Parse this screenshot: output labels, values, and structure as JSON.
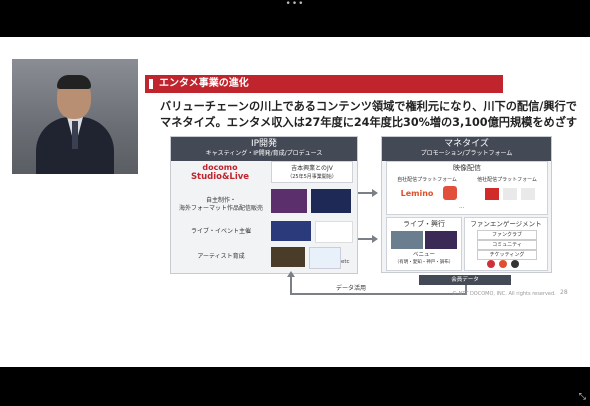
{
  "top_bar": {
    "dots": "•••"
  },
  "slide": {
    "section_title": "エンタメ事業の進化",
    "headline_line1": "バリューチェーンの川上であるコンテンツ領域で権利元になり、川下の配信/興行で",
    "headline_line2": "マネタイズ。エンタメ収入は27年度に24年度比30%増の3,100億円規模をめざす",
    "ip_panel": {
      "title": "IP開発",
      "subtitle": "キャスティング・IP開発/育成/プロデュース",
      "logo_line1": "docomo",
      "logo_line2": "Studio&Live",
      "jv_title": "吉本興業とのJV",
      "jv_note": "（25年5月事業開始）",
      "row1_label_line1": "自主制作・",
      "row1_label_line2": "海外フォーマット作品配信販売",
      "row2_label": "ライブ・イベント主催",
      "row3_label": "アーティスト育成",
      "etc": "etc"
    },
    "monetize_panel": {
      "title": "マネタイズ",
      "subtitle": "プロモーション/プラットフォーム",
      "video_title": "映像配信",
      "own_platform": "自社配信プラットフォーム",
      "other_platform": "他社配信プラットフォーム",
      "lemino": "Lemino",
      "live_title": "ライブ・興行",
      "venue_label": "ベニュー",
      "venue_cities": "（有明・愛知・神戸・調布）",
      "fan_title": "ファンエンゲージメント",
      "fan_items": [
        "ファンクラブ",
        "コミュニティ",
        "チケッティング"
      ]
    },
    "member_data": "会員データ",
    "data_use": "データ活用",
    "copyright": "© NTT DOCOMO, INC.  All rights reserved.",
    "page_number": "28"
  }
}
